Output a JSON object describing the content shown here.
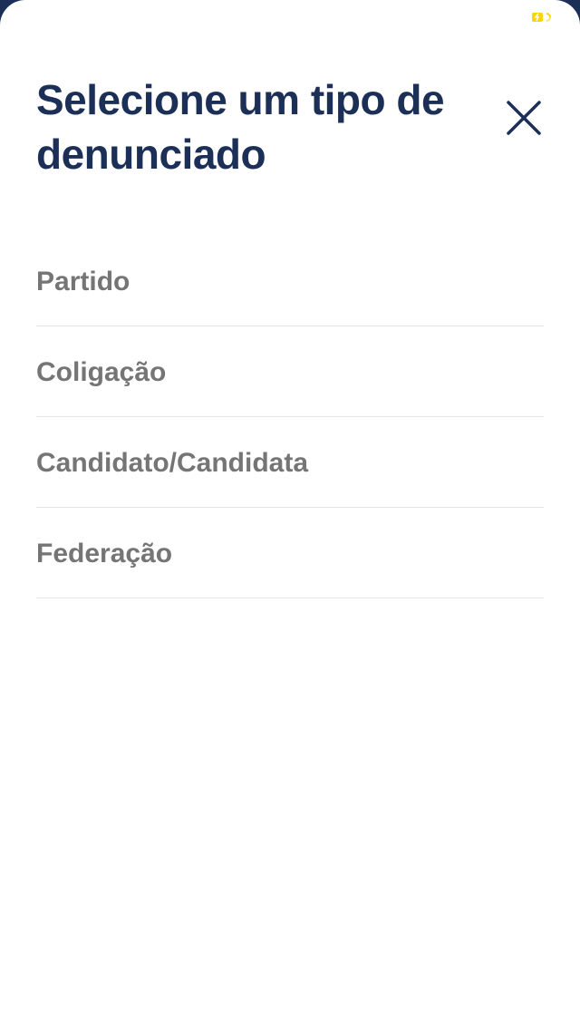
{
  "header": {
    "title": "Selecione um tipo de denunciado"
  },
  "options": [
    {
      "label": "Partido"
    },
    {
      "label": "Coligação"
    },
    {
      "label": "Candidato/Candidata"
    },
    {
      "label": "Federação"
    }
  ],
  "colors": {
    "title": "#1b2f57",
    "option_text": "#757575",
    "divider": "#e4e4e4",
    "backdrop": "#1b2f57",
    "status_indicator": "#ffd400"
  },
  "icons": {
    "close": "close-icon",
    "status": "status-indicator-icon"
  }
}
